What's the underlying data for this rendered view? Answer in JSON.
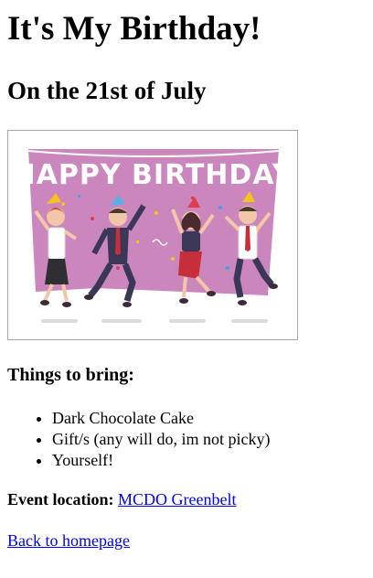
{
  "page": {
    "title": "It's My Birthday!",
    "subtitle": "On the 21st of July"
  },
  "image": {
    "banner_text": "HAPPY BIRTHDAY",
    "background_color": "#cb87bd"
  },
  "bring": {
    "heading": "Things to bring:",
    "items": [
      "Dark Chocolate Cake",
      "Gift/s (any will do, im not picky)",
      "Yourself!"
    ]
  },
  "location": {
    "label": "Event location:",
    "link_text": "MCDO Greenbelt"
  },
  "footer": {
    "back_link": "Back to homepage"
  },
  "colors": {
    "link": "#0000ee",
    "image_border": "#a9a9a9"
  }
}
